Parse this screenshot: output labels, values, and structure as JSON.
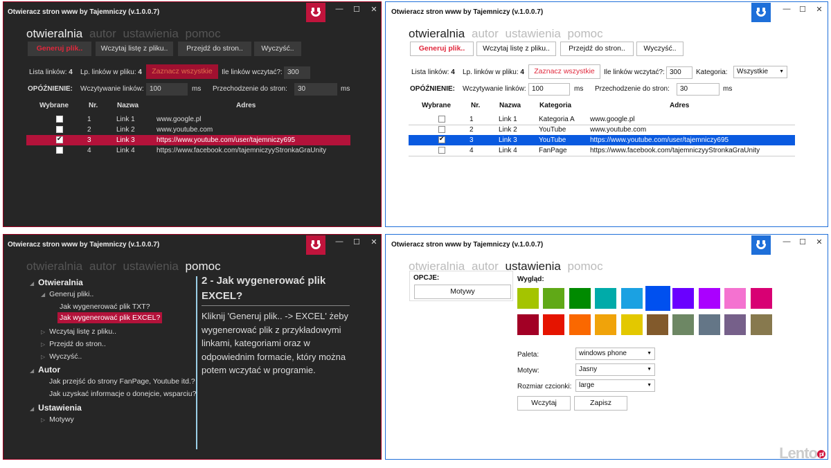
{
  "app_title": "Otwieracz stron www by Tajemniczy (v.1.0.0.7)",
  "window_buttons": {
    "minimize": "—",
    "maximize": "☐",
    "close": "✕"
  },
  "tabs": [
    "otwieralnia",
    "autor",
    "ustawienia",
    "pomoc"
  ],
  "toolbar": {
    "generate": "Generuj plik..",
    "load": "Wczytaj listę z pliku..",
    "goto": "Przejdź do stron..",
    "clear": "Wyczyść.."
  },
  "stats": {
    "list_label": "Lista linków:",
    "list_count": "4",
    "file_label": "Lp. linków w pliku:",
    "file_count": "4",
    "select_all": "Zaznacz wszystkie",
    "load_count_label": "Ile linków wczytać?:",
    "load_count": "300",
    "category_label": "Kategoria:",
    "category_value": "Wszystkie"
  },
  "delay": {
    "label": "OPÓŹNIENIE:",
    "loading_label": "Wczytywanie linków:",
    "loading_value": "100",
    "unit": "ms",
    "goto_label": "Przechodzenie do stron:",
    "goto_value": "30"
  },
  "table": {
    "headers": {
      "selected": "Wybrane",
      "nr": "Nr.",
      "name": "Nazwa",
      "category": "Kategoria",
      "address": "Adres"
    },
    "rows": [
      {
        "checked": false,
        "nr": "1",
        "name": "Link 1",
        "category": "Kategoria A",
        "address": "www.google.pl"
      },
      {
        "checked": false,
        "nr": "2",
        "name": "Link 2",
        "category": "YouTube",
        "address": "www.youtube.com"
      },
      {
        "checked": true,
        "nr": "3",
        "name": "Link 3",
        "category": "YouTube",
        "address": "https://www.youtube.com/user/tajemniczy695"
      },
      {
        "checked": false,
        "nr": "4",
        "name": "Link 4",
        "category": "FanPage",
        "address": "https://www.facebook.com/tajemniczyyStronkaGraUnity"
      }
    ]
  },
  "help_tree": {
    "otwieralnia": "Otwieralnia",
    "generate": "Generuj pliki..",
    "how_txt": "Jak wygenerować plik TXT?",
    "how_excel": "Jak wygenerować plik EXCEL?",
    "load": "Wczytaj listę z pliku..",
    "goto": "Przejdź do stron..",
    "clear": "Wyczyść..",
    "autor": "Autor",
    "fanpage": "Jak przejść do strony FanPage, Youtube itd.?",
    "donate": "Jak uzyskać informacje o donejcie, wsparciu?",
    "ustawienia": "Ustawienia",
    "motywy": "Motywy"
  },
  "help_content": {
    "title": "2 - Jak wygenerować plik EXCEL?",
    "body": "Kliknij 'Generuj plik.. -> EXCEL' żeby wygenerować plik z przykładowymi linkami, kategoriami oraz w odpowiednim formacie, który można potem wczytać w programie."
  },
  "settings": {
    "options_label": "OPCJE:",
    "themes_button": "Motywy",
    "appearance_label": "Wygląd:",
    "palette_label": "Paleta:",
    "palette_value": "windows phone",
    "theme_label": "Motyw:",
    "theme_value": "Jasny",
    "font_size_label": "Rozmiar czcionki:",
    "font_size_value": "large",
    "load_button": "Wczytaj",
    "save_button": "Zapisz",
    "colors_row1": [
      "#a4c400",
      "#60a917",
      "#008a00",
      "#00aba9",
      "#1ba1e2",
      "#0050ef",
      "#6a00ff",
      "#aa00ff",
      "#f472d0",
      "#d80073"
    ],
    "colors_row2": [
      "#a20025",
      "#e51400",
      "#fa6800",
      "#f0a30a",
      "#e3c800",
      "#825a2c",
      "#6d8764",
      "#647687",
      "#76608a",
      "#87794e"
    ]
  },
  "watermark": {
    "brand": "Lento",
    "suffix": "pl"
  }
}
